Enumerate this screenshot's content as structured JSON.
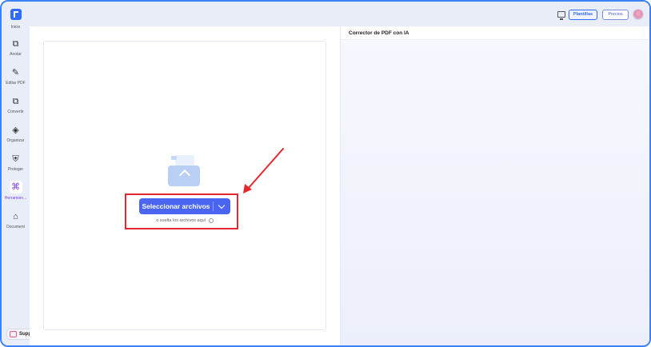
{
  "sidebar": {
    "items": [
      {
        "label": "Inicio",
        "icon": "home-logo-icon"
      },
      {
        "label": "Anotar",
        "icon": "annotate-icon"
      },
      {
        "label": "Editar PDF",
        "icon": "edit-icon"
      },
      {
        "label": "Convertir",
        "icon": "convert-icon"
      },
      {
        "label": "Organizar",
        "icon": "organize-icon"
      },
      {
        "label": "Proteger",
        "icon": "shield-icon"
      },
      {
        "label": "Herramien...",
        "icon": "tools-icon"
      },
      {
        "label": "Document",
        "icon": "document-home-icon"
      }
    ],
    "support_label": "Support"
  },
  "topbar": {
    "plantillas_label": "Plantillas",
    "precios_label": "Precios"
  },
  "main": {
    "select_button_label": "Seleccionar archivos",
    "drop_hint": "o suelta los archivos aquí"
  },
  "right_panel": {
    "title": "Corrector de PDF con IA"
  },
  "colors": {
    "accent": "#4a66f0",
    "highlight": "#e8262d",
    "frame": "#3b82f6"
  }
}
